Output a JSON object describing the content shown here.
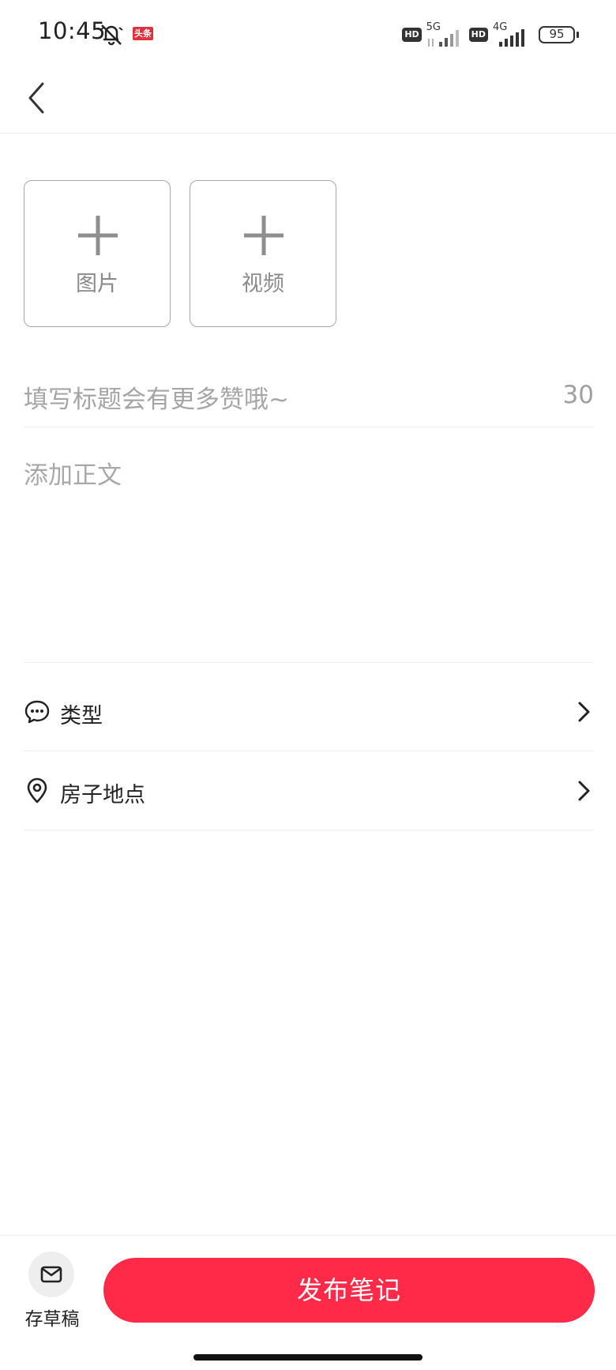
{
  "status_bar": {
    "time": "10:45",
    "news_badge": "头条",
    "sim1_hd": "HD",
    "sim1_network": "5G",
    "sim2_hd": "HD",
    "sim2_network": "4G",
    "battery": "95"
  },
  "media": {
    "image_label": "图片",
    "video_label": "视频"
  },
  "title_field": {
    "placeholder": "填写标题会有更多赞哦~",
    "remaining": "30"
  },
  "body_field": {
    "placeholder": "添加正文"
  },
  "options": [
    {
      "label": "类型",
      "icon": "chat-bubble-icon"
    },
    {
      "label": "房子地点",
      "icon": "location-pin-icon"
    }
  ],
  "bottom": {
    "draft_label": "存草稿",
    "publish_label": "发布笔记"
  },
  "colors": {
    "accent": "#fe2a48"
  }
}
